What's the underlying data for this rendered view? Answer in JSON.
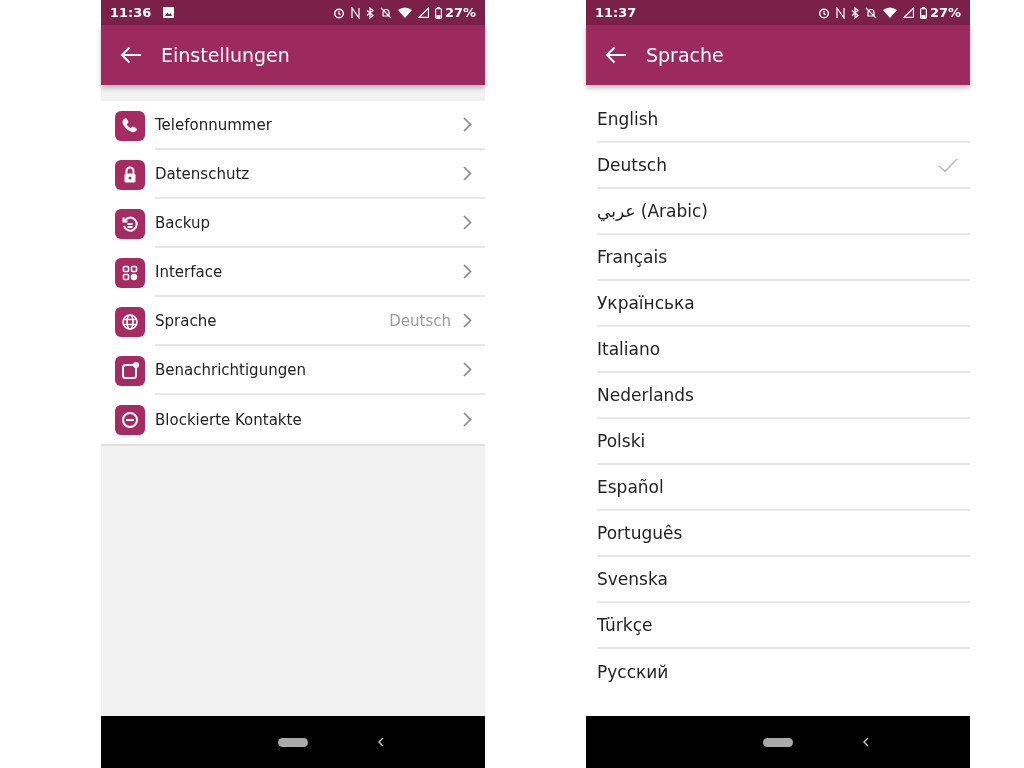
{
  "screens": [
    {
      "status_bar": {
        "time": "11:36",
        "battery": "27%",
        "image_notification": true
      },
      "app_bar": {
        "title": "Einstellungen"
      },
      "settings": [
        {
          "label": "Telefonnummer"
        },
        {
          "label": "Datenschutz"
        },
        {
          "label": "Backup"
        },
        {
          "label": "Interface"
        },
        {
          "label": "Sprache",
          "value": "Deutsch"
        },
        {
          "label": "Benachrichtigungen"
        },
        {
          "label": "Blockierte Kontakte"
        }
      ]
    },
    {
      "status_bar": {
        "time": "11:37",
        "battery": "27%",
        "image_notification": false
      },
      "app_bar": {
        "title": "Sprache"
      },
      "languages": [
        {
          "label": "English",
          "selected": false
        },
        {
          "label": "Deutsch",
          "selected": true
        },
        {
          "label": "عربي (Arabic)",
          "selected": false
        },
        {
          "label": "Français",
          "selected": false
        },
        {
          "label": "Українська",
          "selected": false
        },
        {
          "label": "Italiano",
          "selected": false
        },
        {
          "label": "Nederlands",
          "selected": false
        },
        {
          "label": "Polski",
          "selected": false
        },
        {
          "label": "Español",
          "selected": false
        },
        {
          "label": "Português",
          "selected": false
        },
        {
          "label": "Svenska",
          "selected": false
        },
        {
          "label": "Türkçe",
          "selected": false
        },
        {
          "label": "Русский",
          "selected": false
        }
      ]
    }
  ]
}
